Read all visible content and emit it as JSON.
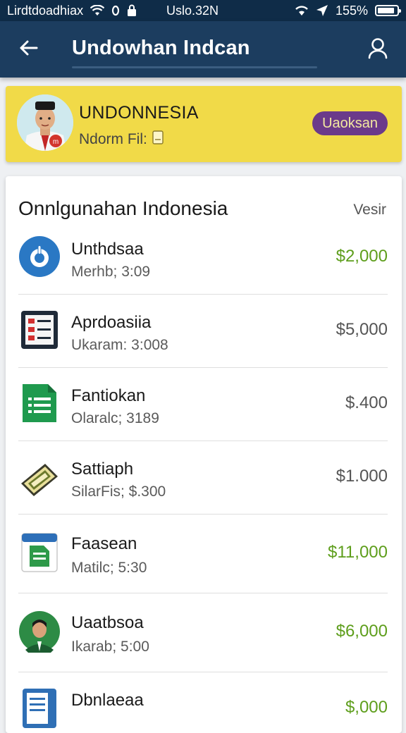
{
  "status_bar": {
    "left_text": "Lirdtdoadhiax",
    "center_text": "Uslo.32N",
    "battery_percent": "155%",
    "battery_fill": 0.9,
    "icons": [
      "wifi-icon",
      "circle-icon",
      "lock-icon",
      "signal-icon",
      "location-icon",
      "battery-icon"
    ]
  },
  "app_bar": {
    "title": "Undowhan Indcan",
    "back_icon": "arrow-left-icon",
    "profile_icon": "user-icon",
    "bg_color": "#1c3d5f"
  },
  "banner": {
    "title": "UNDONNESIA",
    "subtitle": "Ndorm Fil:",
    "button_label": "Uaoksan",
    "bg_color": "#f1da48",
    "button_color": "#6b3a8a"
  },
  "list_card": {
    "title": "Onnlgunahan Indonesia",
    "link_label": "Vesir",
    "items": [
      {
        "title": "Unthdsaa",
        "subtitle": "Merhb; 3:09",
        "amount": "$2,000",
        "amount_color": "green",
        "icon": "power-icon"
      },
      {
        "title": "Aprdoasiia",
        "subtitle": "Ukaram: 3:008",
        "amount": "$5,000",
        "amount_color": "gray",
        "icon": "checklist-icon"
      },
      {
        "title": "Fantiokan",
        "subtitle": "Olaralc; 3189",
        "amount": "$.400",
        "amount_color": "gray",
        "icon": "spreadsheet-icon"
      },
      {
        "title": "Sattiaph",
        "subtitle": "SilarFis; $.300",
        "amount": "$1.000",
        "amount_color": "gray",
        "icon": "ticket-icon"
      },
      {
        "title": "Faasean",
        "subtitle": "Matilc; 5:30",
        "amount": "$11,000",
        "amount_color": "green",
        "icon": "document-icon"
      },
      {
        "title": "Uaatbsoa",
        "subtitle": "Ikarab; 5:00",
        "amount": "$6,000",
        "amount_color": "green",
        "icon": "avatar-icon"
      },
      {
        "title": "Dbnlaeaa",
        "subtitle": "",
        "amount": "$,000",
        "amount_color": "green",
        "icon": "file-icon"
      }
    ]
  }
}
